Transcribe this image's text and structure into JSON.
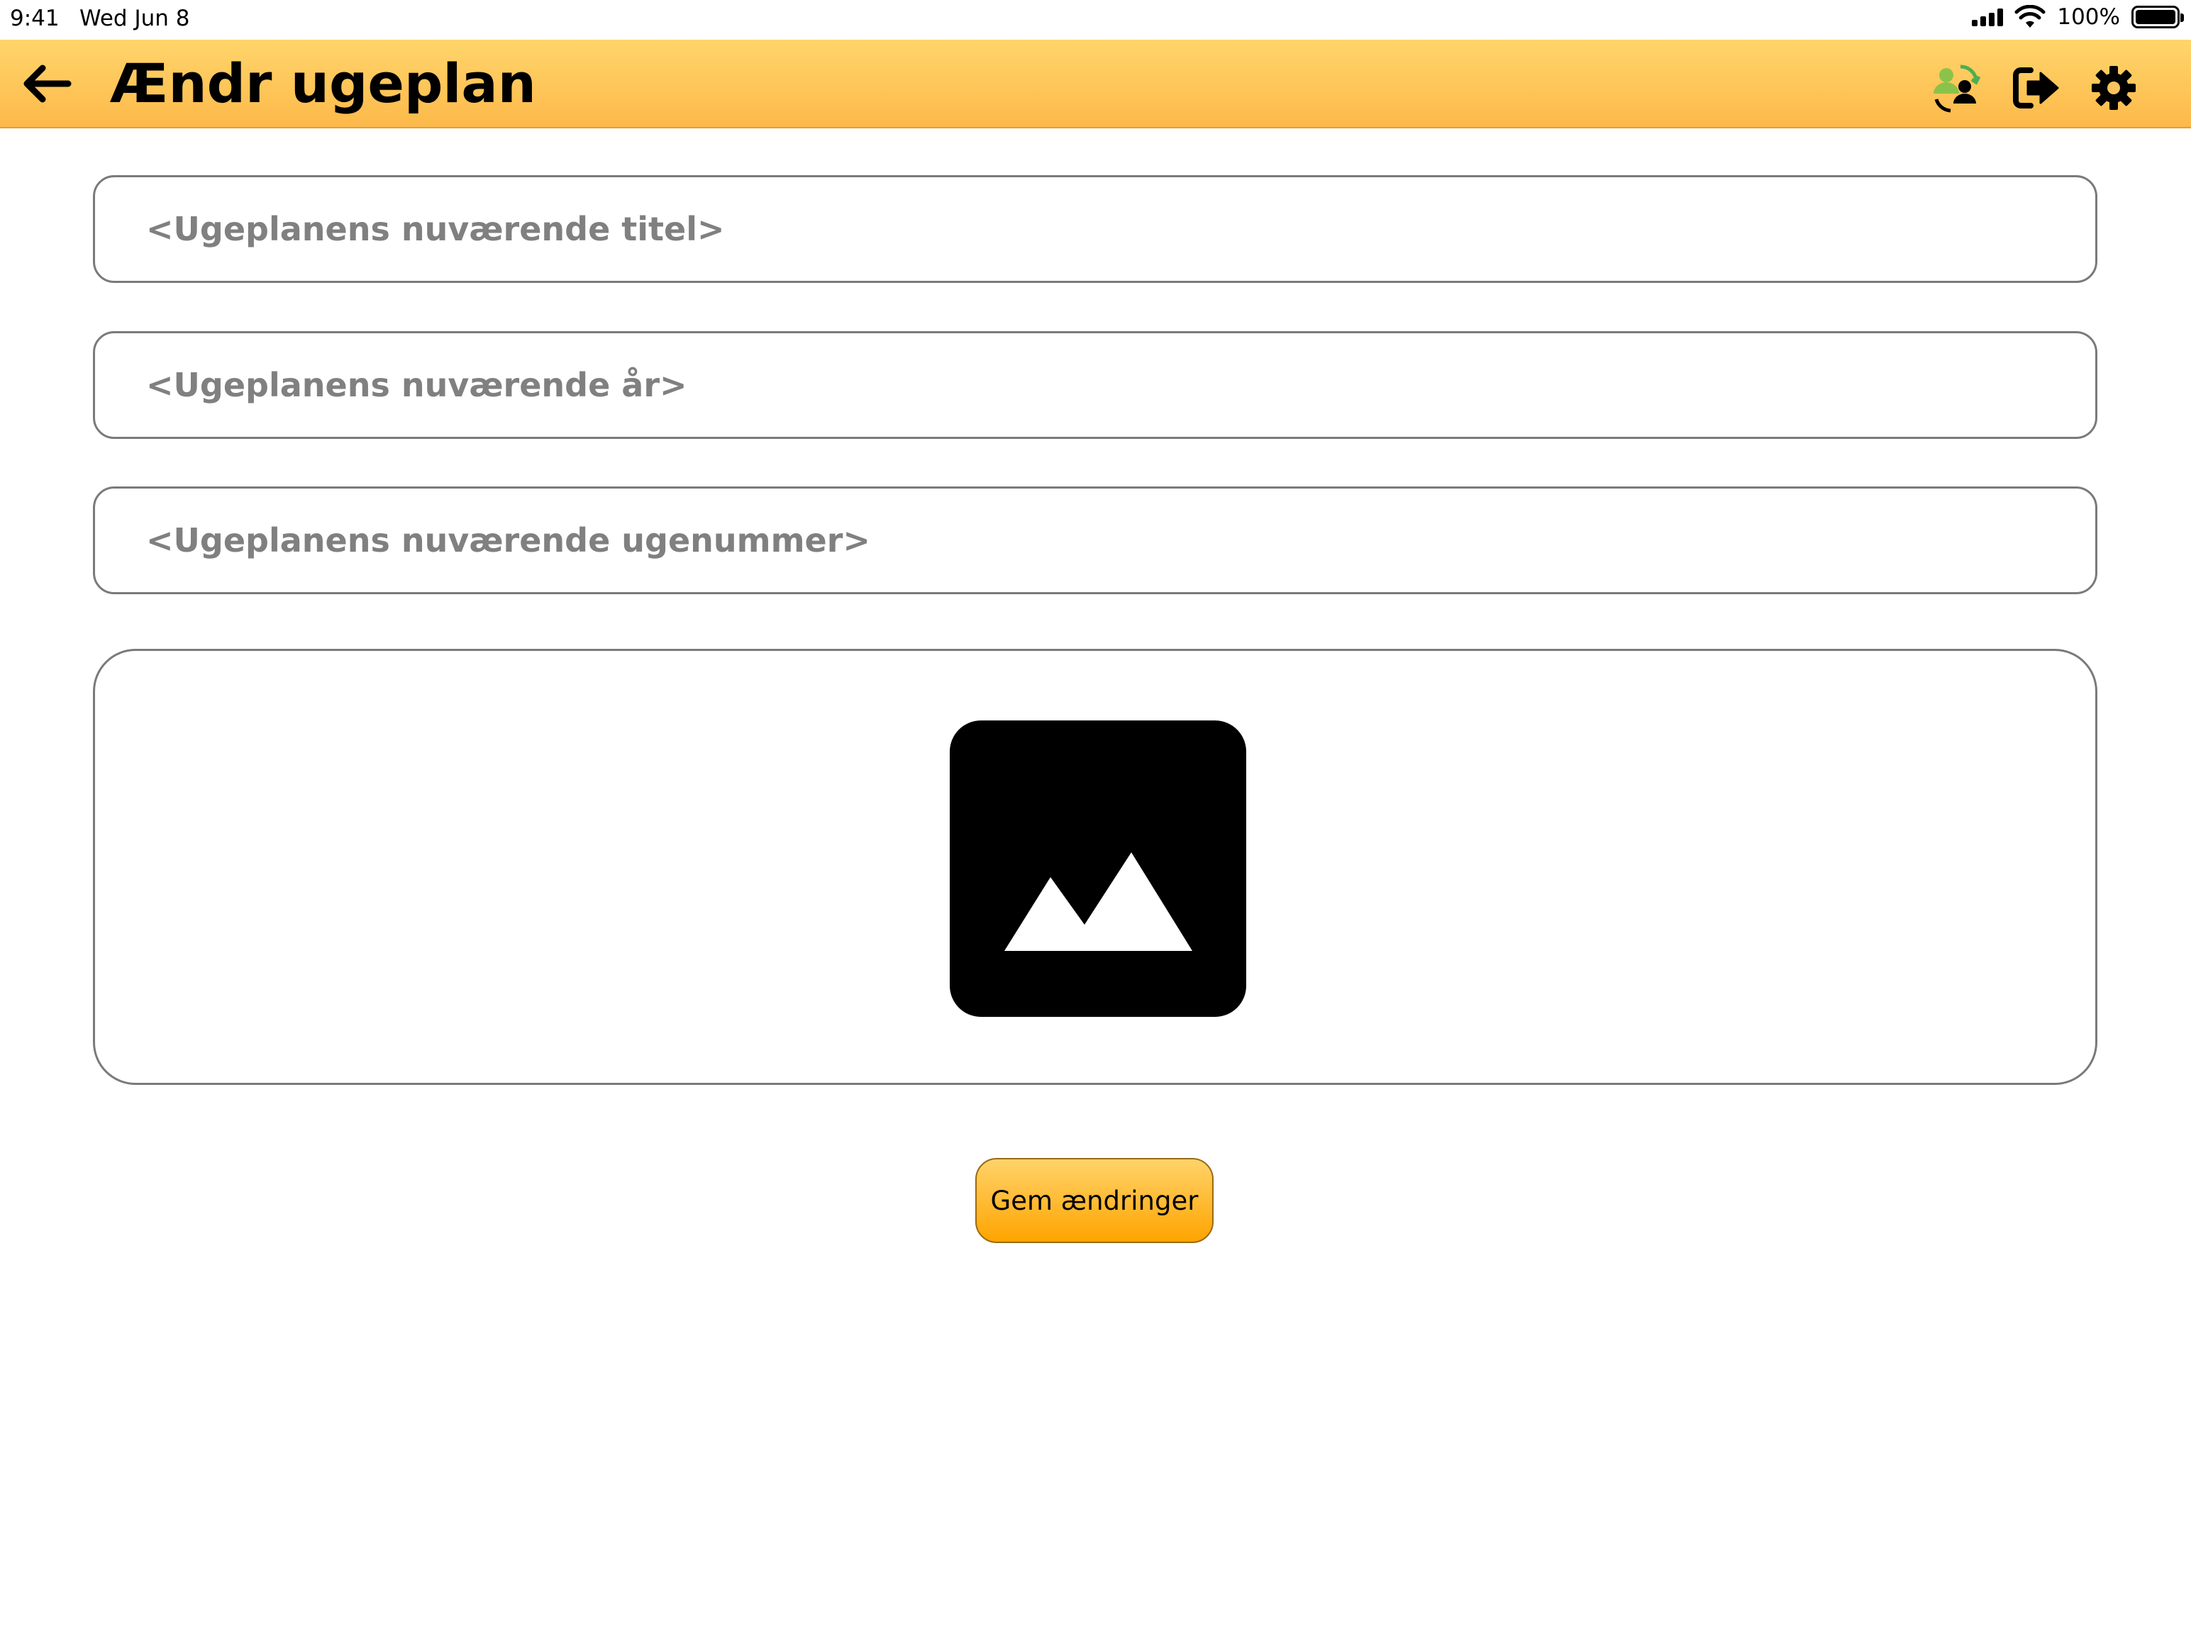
{
  "status_bar": {
    "time": "9:41",
    "date": "Wed Jun 8",
    "battery_percent": "100%",
    "icons": [
      "cellular-signal-icon",
      "wifi-icon",
      "battery-icon"
    ]
  },
  "header": {
    "title": "Ændr ugeplan",
    "background_colors": [
      "#ffd56b",
      "#fdb94a"
    ],
    "icons": [
      "back-arrow-icon",
      "switch-user-icon",
      "logout-icon",
      "settings-gear-icon"
    ]
  },
  "form": {
    "title_placeholder": "<Ugeplanens nuværende titel>",
    "year_placeholder": "<Ugeplanens nuværende år>",
    "week_placeholder": "<Ugeplanens nuværende ugenummer>",
    "image_icon": "image-placeholder-icon",
    "save_label": "Gem ændringer",
    "save_button_color": "#ffa400"
  }
}
